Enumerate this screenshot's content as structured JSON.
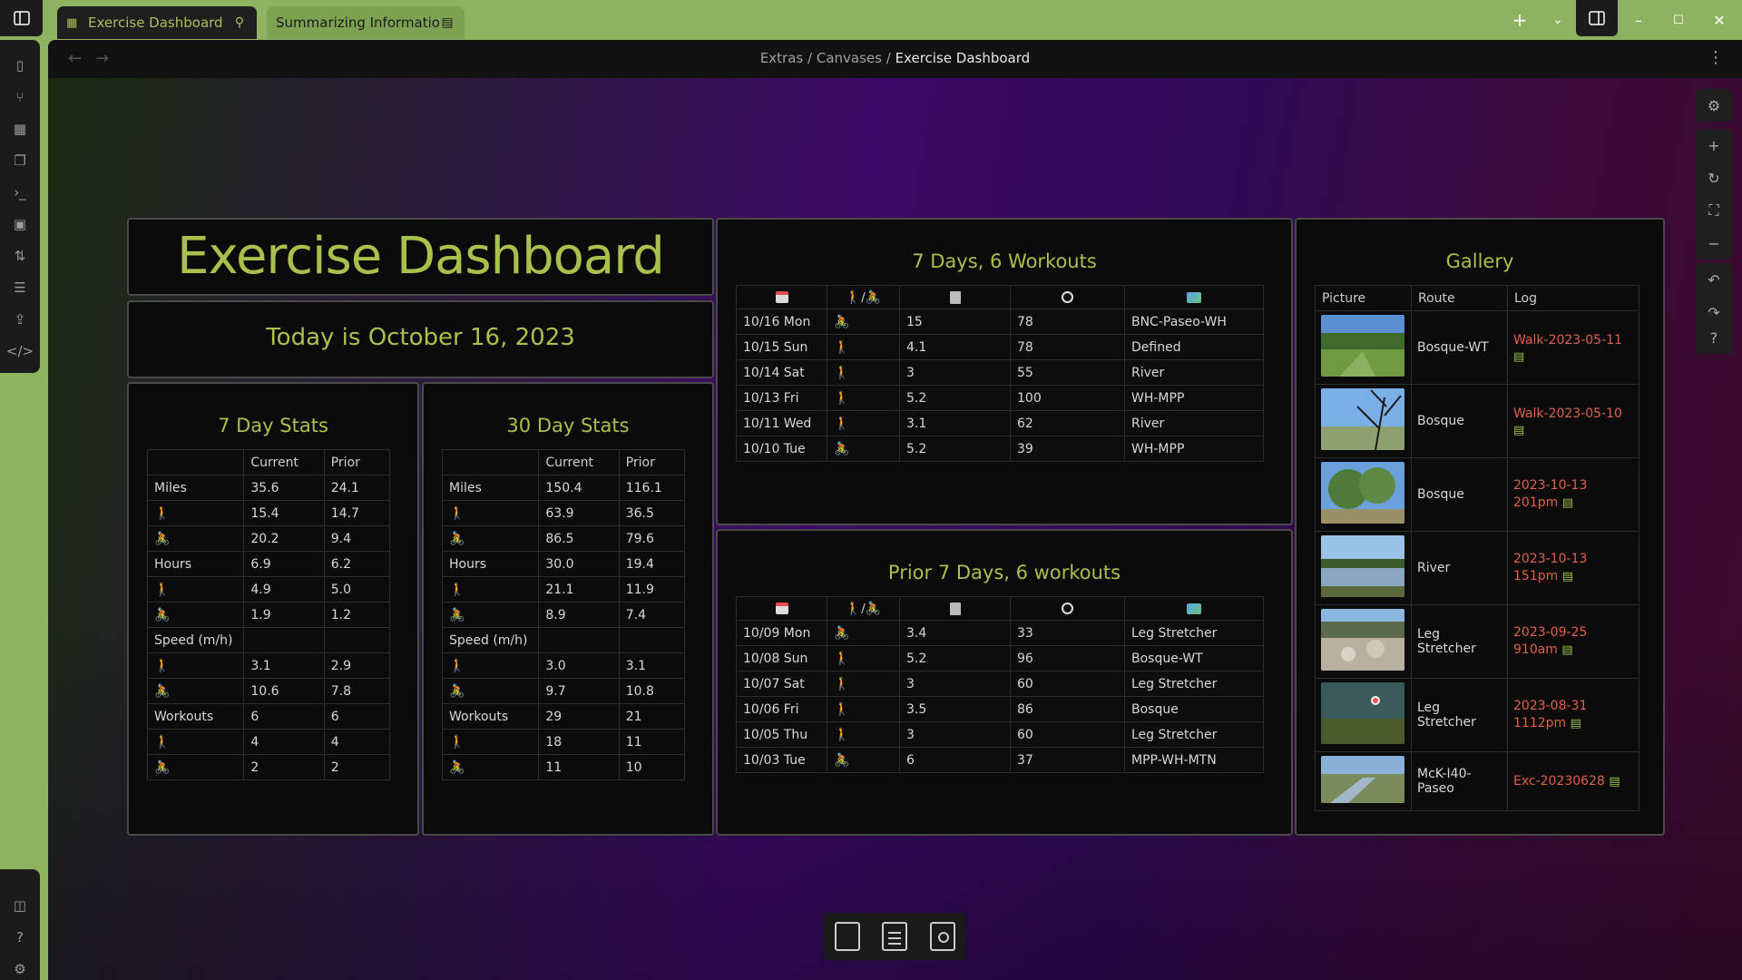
{
  "tabs": [
    {
      "label": "Exercise Dashboard",
      "icon": "dashboard-icon",
      "right_icon": "pin-icon"
    },
    {
      "label": "Summarizing Informatio...",
      "icon": "",
      "right_icon": "clipboard-icon"
    }
  ],
  "breadcrumb": {
    "items": [
      "Extras",
      "Canvases"
    ],
    "current": "Exercise Dashboard",
    "sep": "/"
  },
  "title": "Exercise Dashboard",
  "today": "Today is October 16, 2023",
  "stats_headers": [
    "",
    "Current",
    "Prior"
  ],
  "stats7": {
    "heading": "7 Day Stats",
    "rows": [
      [
        "Miles",
        "35.6",
        "24.1"
      ],
      [
        "walk",
        "15.4",
        "14.7"
      ],
      [
        "bike",
        "20.2",
        "9.4"
      ],
      [
        "Hours",
        "6.9",
        "6.2"
      ],
      [
        "walk",
        "4.9",
        "5.0"
      ],
      [
        "bike",
        "1.9",
        "1.2"
      ],
      [
        "Speed (m/h)",
        "",
        ""
      ],
      [
        "walk",
        "3.1",
        "2.9"
      ],
      [
        "bike",
        "10.6",
        "7.8"
      ],
      [
        "Workouts",
        "6",
        "6"
      ],
      [
        "walk",
        "4",
        "4"
      ],
      [
        "bike",
        "2",
        "2"
      ]
    ]
  },
  "stats30": {
    "heading": "30 Day Stats",
    "rows": [
      [
        "Miles",
        "150.4",
        "116.1"
      ],
      [
        "walk",
        "63.9",
        "36.5"
      ],
      [
        "bike",
        "86.5",
        "79.6"
      ],
      [
        "Hours",
        "30.0",
        "19.4"
      ],
      [
        "walk",
        "21.1",
        "11.9"
      ],
      [
        "bike",
        "8.9",
        "7.4"
      ],
      [
        "Speed (m/h)",
        "",
        ""
      ],
      [
        "walk",
        "3.0",
        "3.1"
      ],
      [
        "bike",
        "9.7",
        "10.8"
      ],
      [
        "Workouts",
        "29",
        "21"
      ],
      [
        "walk",
        "18",
        "11"
      ],
      [
        "bike",
        "11",
        "10"
      ]
    ]
  },
  "week": {
    "heading": "7 Days, 6 Workouts",
    "rows": [
      [
        "10/16 Mon",
        "bike",
        "15",
        "78",
        "BNC-Paseo-WH"
      ],
      [
        "10/15 Sun",
        "walk",
        "4.1",
        "78",
        "Defined"
      ],
      [
        "10/14 Sat",
        "walk",
        "3",
        "55",
        "River"
      ],
      [
        "10/13 Fri",
        "walk",
        "5.2",
        "100",
        "WH-MPP"
      ],
      [
        "10/11 Wed",
        "walk",
        "3.1",
        "62",
        "River"
      ],
      [
        "10/10 Tue",
        "bike",
        "5.2",
        "39",
        "WH-MPP"
      ]
    ]
  },
  "prior": {
    "heading": "Prior 7 Days, 6 workouts",
    "rows": [
      [
        "10/09 Mon",
        "bike",
        "3.4",
        "33",
        "Leg Stretcher"
      ],
      [
        "10/08 Sun",
        "walk",
        "5.2",
        "96",
        "Bosque-WT"
      ],
      [
        "10/07 Sat",
        "walk",
        "3",
        "60",
        "Leg Stretcher"
      ],
      [
        "10/06 Fri",
        "walk",
        "3.5",
        "86",
        "Bosque"
      ],
      [
        "10/05 Thu",
        "walk",
        "3",
        "60",
        "Leg Stretcher"
      ],
      [
        "10/03 Tue",
        "bike",
        "6",
        "37",
        "MPP-WH-MTN"
      ]
    ]
  },
  "workout_header_icons": [
    "calendar-icon",
    "walk-bike-icon",
    "notebook-icon",
    "stopwatch-icon",
    "map-icon"
  ],
  "gallery": {
    "heading": "Gallery",
    "headers": [
      "Picture",
      "Route",
      "Log"
    ],
    "rows": [
      {
        "route": "Bosque-WT",
        "log": "Walk-2023-05-11",
        "scene": "meadow"
      },
      {
        "route": "Bosque",
        "log": "Walk-2023-05-10",
        "scene": "branches"
      },
      {
        "route": "Bosque",
        "log": "2023-10-13 201pm",
        "scene": "trees"
      },
      {
        "route": "River",
        "log": "2023-10-13 151pm",
        "scene": "river"
      },
      {
        "route": "Leg Stretcher",
        "log": "2023-09-25 910am",
        "scene": "rocks"
      },
      {
        "route": "Leg Stretcher",
        "log": "2023-08-31 1112pm",
        "scene": "night"
      },
      {
        "route": "McK-I40-Paseo",
        "log": "Exc-20230628",
        "scene": "channel"
      }
    ]
  },
  "colors": {
    "accent": "#a8c04c",
    "link": "#e0604a",
    "frame": "#8db361"
  }
}
